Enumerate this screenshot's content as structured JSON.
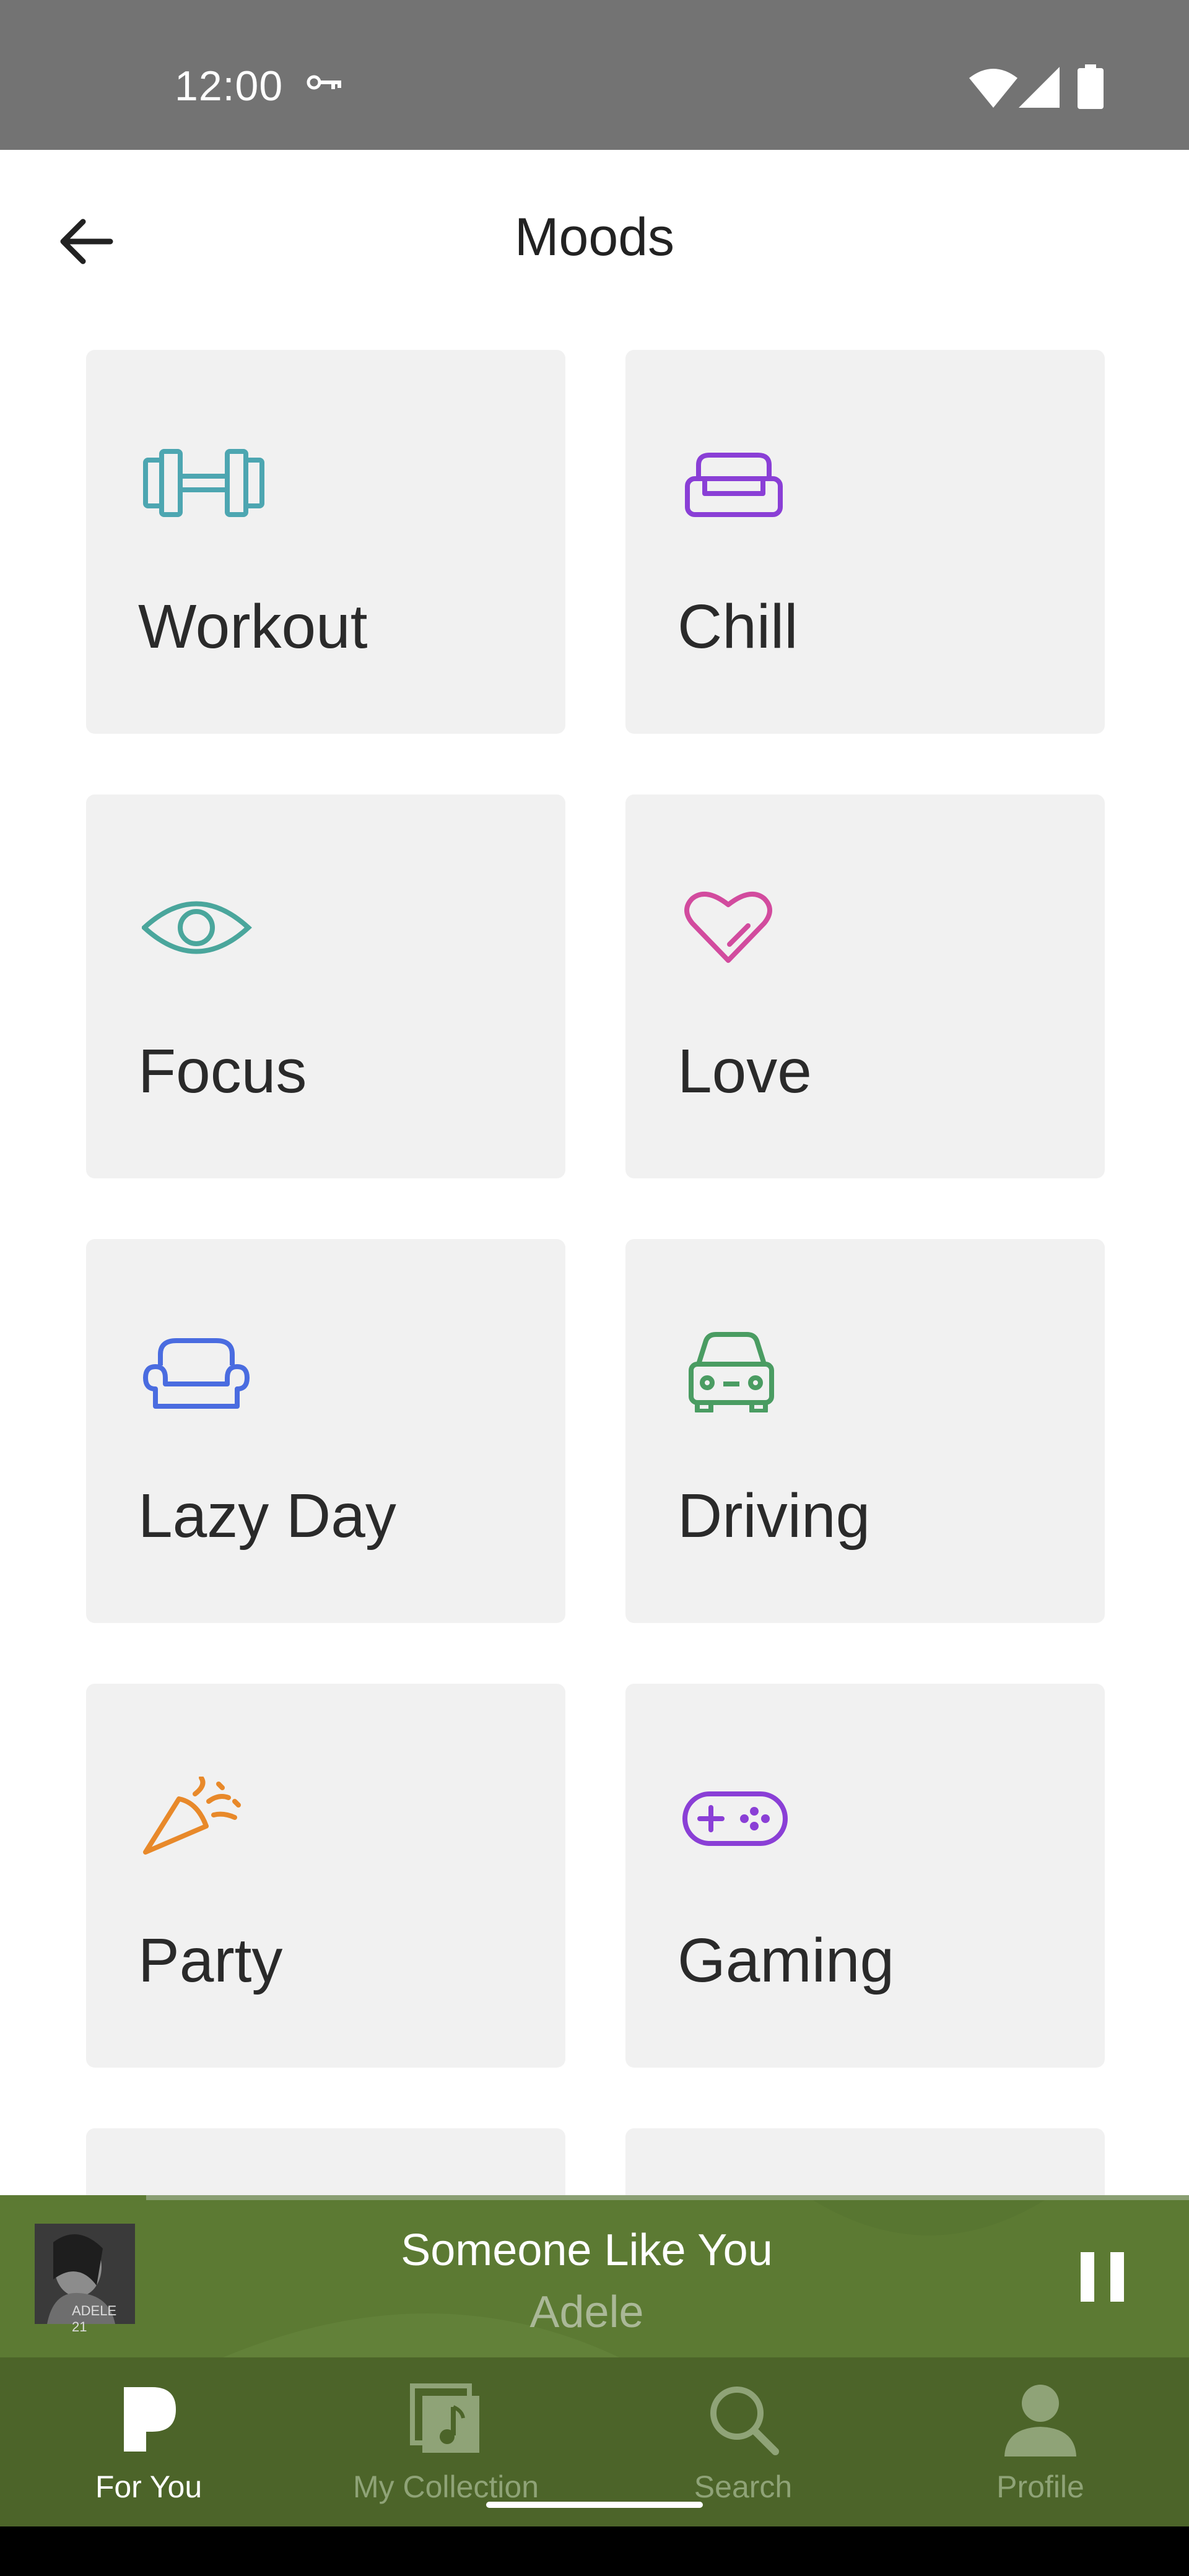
{
  "status_bar": {
    "time": "12:00"
  },
  "header": {
    "title": "Moods"
  },
  "moods": [
    {
      "label": "Workout",
      "icon": "dumbbell-icon",
      "color": "#4da6b1"
    },
    {
      "label": "Chill",
      "icon": "couch-icon",
      "color": "#8a3fd6"
    },
    {
      "label": "Focus",
      "icon": "eye-icon",
      "color": "#4aa69c"
    },
    {
      "label": "Love",
      "icon": "heart-icon",
      "color": "#d24b9e"
    },
    {
      "label": "Lazy Day",
      "icon": "sofa-icon",
      "color": "#4a6ce0"
    },
    {
      "label": "Driving",
      "icon": "car-icon",
      "color": "#4a9c62"
    },
    {
      "label": "Party",
      "icon": "party-popper-icon",
      "color": "#e8892a"
    },
    {
      "label": "Gaming",
      "icon": "gamepad-icon",
      "color": "#8a3fd6"
    }
  ],
  "now_playing": {
    "song": "Someone Like You",
    "artist": "Adele",
    "album_art_text": "ADELE 21"
  },
  "bottom_nav": [
    {
      "label": "For You",
      "icon": "pandora-p-icon",
      "active": true
    },
    {
      "label": "My Collection",
      "icon": "collection-icon",
      "active": false
    },
    {
      "label": "Search",
      "icon": "search-icon",
      "active": false
    },
    {
      "label": "Profile",
      "icon": "profile-icon",
      "active": false
    }
  ],
  "colors": {
    "player_bg": "#5c7a33",
    "nav_bg": "#4c6429",
    "nav_active": "#ffffff",
    "nav_inactive": "#8fa377"
  }
}
